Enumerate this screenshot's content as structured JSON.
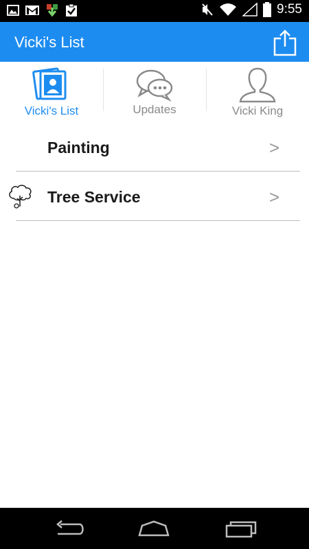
{
  "status_bar": {
    "time": "9:55",
    "icons": [
      "image-icon",
      "gmail-icon",
      "download-icon",
      "clipboard-check-icon",
      "mute-icon",
      "wifi-icon",
      "signal-icon",
      "battery-icon"
    ]
  },
  "action_bar": {
    "title": "Vicki's List",
    "share_icon": "share-icon"
  },
  "tabs": [
    {
      "label": "Vicki's List",
      "icon": "photos-icon",
      "active": true
    },
    {
      "label": "Updates",
      "icon": "chat-bubbles-icon",
      "active": false
    },
    {
      "label": "Vicki King",
      "icon": "person-icon",
      "active": false
    }
  ],
  "list": {
    "items": [
      {
        "label": "Painting",
        "icon": "",
        "chevron": ">"
      },
      {
        "label": "Tree Service",
        "icon": "tree-icon",
        "chevron": ">"
      }
    ]
  },
  "colors": {
    "accent": "#1d8cf0",
    "inactive": "#8a8a8a"
  },
  "nav_bar": {
    "icons": [
      "back-icon",
      "home-icon",
      "recent-apps-icon"
    ]
  }
}
